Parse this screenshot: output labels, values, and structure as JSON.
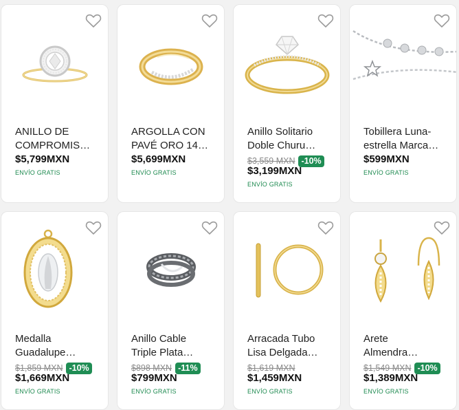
{
  "products": [
    {
      "title": "ANILLO DE\nCOMPROMIS…",
      "old_price": "",
      "discount": "",
      "price": "$5,799MXN",
      "shipping": "ENVÍO GRATIS",
      "image": "solitaire-halo-ring"
    },
    {
      "title": "ARGOLLA CON\nPAVÉ ORO 14…",
      "old_price": "",
      "discount": "",
      "price": "$5,699MXN",
      "shipping": "ENVÍO GRATIS",
      "image": "gold-pave-band"
    },
    {
      "title": "Anillo Solitario\nDoble Churu…",
      "old_price": "$3,559 MXN",
      "discount": "-10%",
      "price": "$3,199MXN",
      "shipping": "ENVÍO GRATIS",
      "image": "gold-solitaire-ring"
    },
    {
      "title": "Tobillera Luna-\nestrella Marca…",
      "old_price": "",
      "discount": "",
      "price": "$599MXN",
      "shipping": "ENVÍO GRATIS",
      "image": "silver-anklet-star"
    },
    {
      "title": "Medalla\nGuadalupe…",
      "old_price": "$1,859 MXN",
      "discount": "-10%",
      "price": "$1,669MXN",
      "shipping": "ENVÍO GRATIS",
      "image": "guadalupe-medal"
    },
    {
      "title": "Anillo Cable\nTriple Plata…",
      "old_price": "$898 MXN",
      "discount": "-11%",
      "price": "$799MXN",
      "shipping": "ENVÍO GRATIS",
      "image": "silver-cable-ring"
    },
    {
      "title": "Arracada Tubo\nLisa Delgada…",
      "old_price": "$1,619 MXN",
      "discount": "",
      "price": "$1,459MXN",
      "shipping": "ENVÍO GRATIS",
      "image": "gold-hoop-earring"
    },
    {
      "title": "Arete\nAlmendra…",
      "old_price": "$1,549 MXN",
      "discount": "-10%",
      "price": "$1,389MXN",
      "shipping": "ENVÍO GRATIS",
      "image": "almond-drop-earrings"
    }
  ],
  "colors": {
    "accent_green": "#1f8d54",
    "gold": "#e3c15b",
    "silver": "#b9bcc0"
  }
}
